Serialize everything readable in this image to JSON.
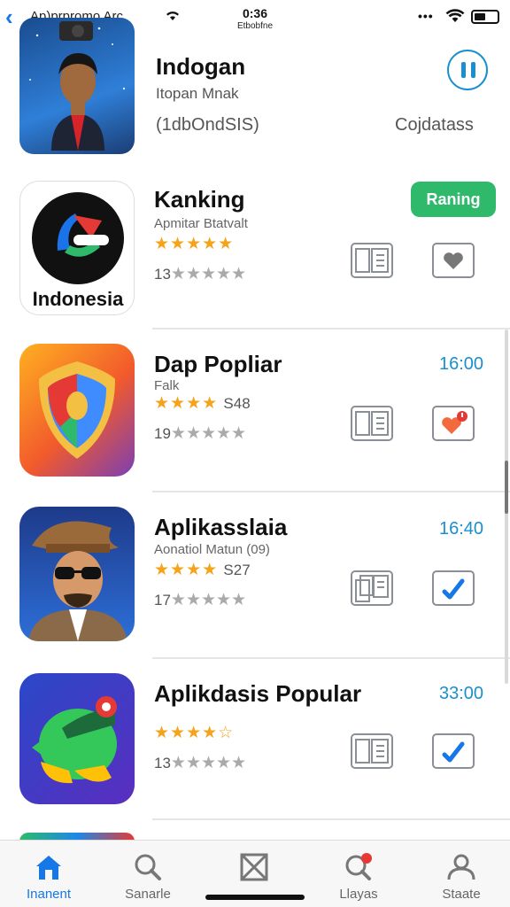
{
  "status_bar": {
    "app_label": "Ap)prpromo Arc",
    "time": "0:36",
    "sub": "Etbobfne"
  },
  "header": {
    "title": "Indogan",
    "subtitle": "Itopan Mnak",
    "meta": "(1dbOndSIS)",
    "side_label": "Cojdatass"
  },
  "apps": [
    {
      "name": "Kanking",
      "subtitle": "Apmitar Btatvalt",
      "stars": "★★★★★",
      "stars_extra": "",
      "count": "13",
      "count_stars": "★★★★★",
      "action_label": "Raning",
      "icon_caption": "Indonesia"
    },
    {
      "name": "Dap Popliar",
      "subtitle": "Falk",
      "stars": "★★★★",
      "stars_extra": "S48",
      "count": "19",
      "count_stars": "★★★★★",
      "time": "16:00"
    },
    {
      "name": "Aplikasslaia",
      "subtitle": "Aonatiol Matun (09)",
      "stars": "★★★★",
      "stars_extra": "S27",
      "count": "17",
      "count_stars": "★★★★★",
      "time": "16:40"
    },
    {
      "name": "Aplikdasis Popular",
      "subtitle": "",
      "stars": "★★★★☆",
      "stars_extra": "",
      "count": "13",
      "count_stars": "★★★★★",
      "time": "33:00"
    }
  ],
  "tabs": [
    {
      "label": "Inanent",
      "icon": "home-icon"
    },
    {
      "label": "Sanarle",
      "icon": "search-icon"
    },
    {
      "label": "",
      "icon": "apps-icon"
    },
    {
      "label": "Llayas",
      "icon": "notifications-icon"
    },
    {
      "label": "Staate",
      "icon": "profile-icon"
    }
  ],
  "colors": {
    "accent": "#1a8fd0",
    "tab_active": "#1677e6",
    "get_button": "#2fba6b",
    "star": "#f4a31b"
  }
}
